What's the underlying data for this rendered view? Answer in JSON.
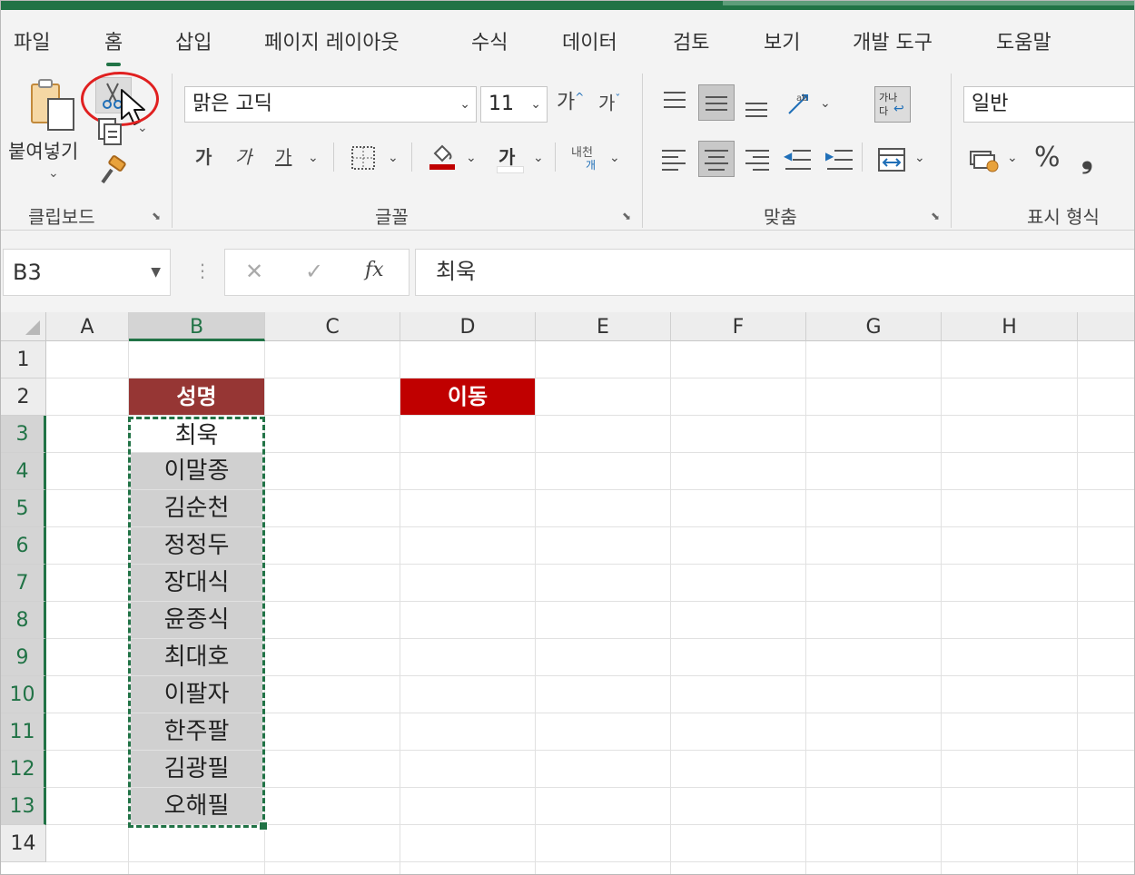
{
  "tabs": [
    "파일",
    "홈",
    "삽입",
    "페이지 레이아웃",
    "수식",
    "데이터",
    "검토",
    "보기",
    "개발 도구",
    "도움말"
  ],
  "active_tab": "홈",
  "ribbon": {
    "clipboard": {
      "label": "클립보드",
      "paste_label": "붙여넣기",
      "cut_icon": "scissors-icon",
      "copy_icon": "copy-icon",
      "format_painter_icon": "paintbrush-icon"
    },
    "font": {
      "label": "글꼴",
      "font_name": "맑은 고딕",
      "font_size": "11",
      "grow": "가",
      "shrink": "가",
      "bold": "가",
      "italic": "가",
      "underline": "가",
      "font_color_glyph": "가",
      "phonetic_top": "내천",
      "phonetic_bottom": "개"
    },
    "alignment": {
      "label": "맞춤",
      "wrap_top": "가나",
      "wrap_bottom": "다"
    },
    "number": {
      "label": "표시 형식",
      "format": "일반",
      "percent": "%",
      "comma": "❟"
    }
  },
  "formula_bar": {
    "name_box": "B3",
    "fx": "fx",
    "cancel": "✕",
    "enter": "✓",
    "content": "최욱"
  },
  "grid": {
    "columns": [
      "A",
      "B",
      "C",
      "D",
      "E",
      "F",
      "G",
      "H"
    ],
    "selected_column": "B",
    "rows": [
      "1",
      "2",
      "3",
      "4",
      "5",
      "6",
      "7",
      "8",
      "9",
      "10",
      "11",
      "12",
      "13",
      "14"
    ],
    "selected_rows": [
      "3",
      "4",
      "5",
      "6",
      "7",
      "8",
      "9",
      "10",
      "11",
      "12",
      "13"
    ],
    "header_b2": "성명",
    "header_d2": "이동",
    "names": [
      "최욱",
      "이말종",
      "김순천",
      "정정두",
      "장대식",
      "윤종식",
      "최대호",
      "이팔자",
      "한주팔",
      "김광필",
      "오해필"
    ],
    "colors": {
      "header_b": "#963634",
      "header_d": "#c00000",
      "selection_fill": "#d0d0d0",
      "accent": "#217346"
    }
  }
}
